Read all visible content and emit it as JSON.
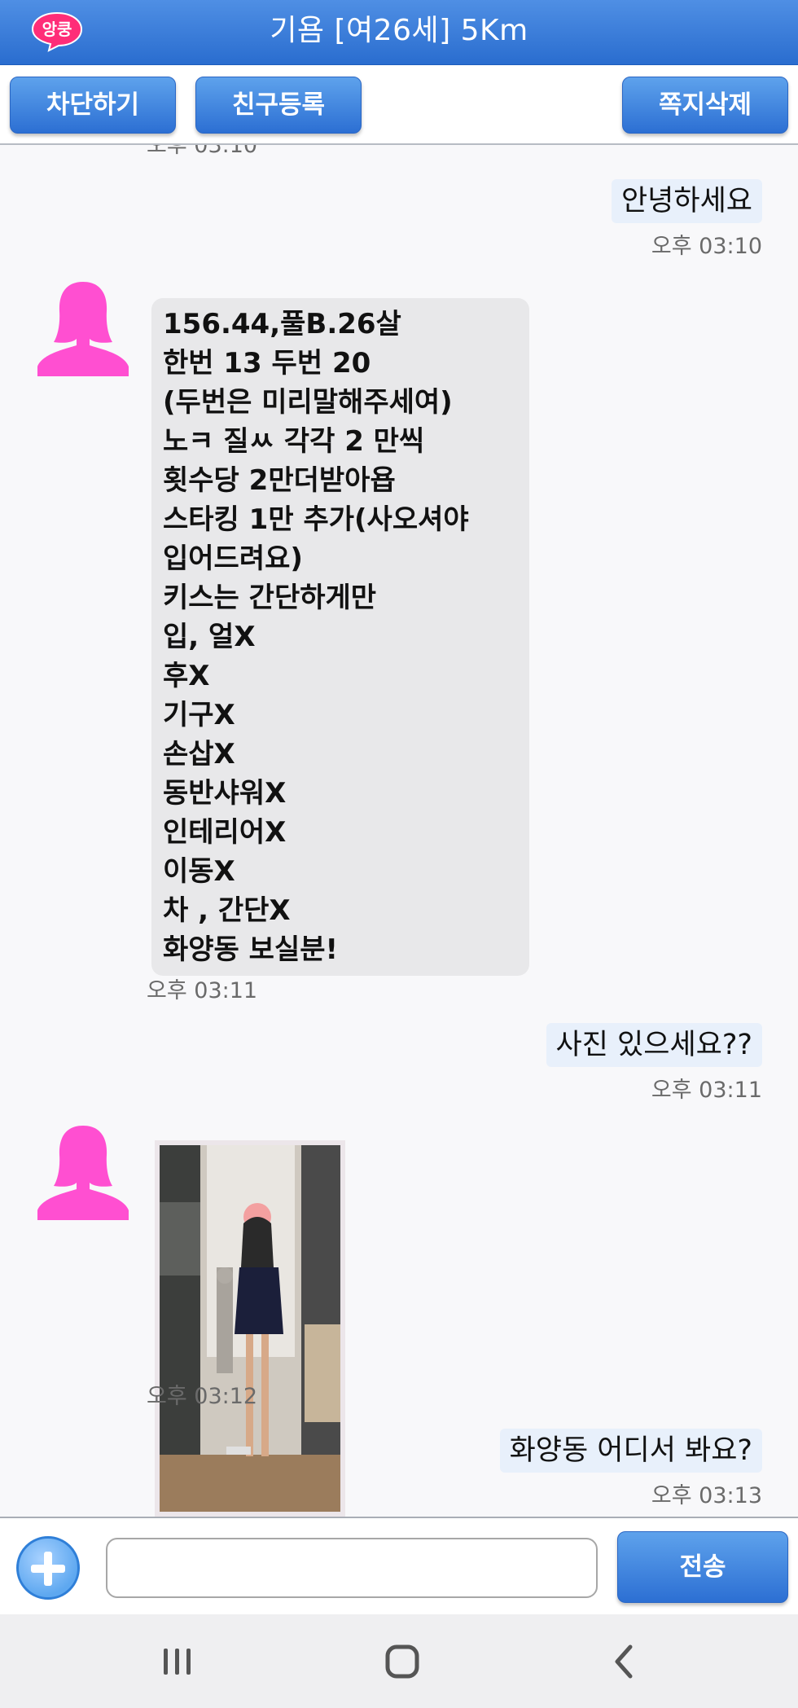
{
  "header": {
    "logo_text": "앙쿵",
    "title": "기욤 [여26세] 5Km"
  },
  "toolbar": {
    "block_label": "차단하기",
    "friend_label": "친구등록",
    "delete_label": "쪽지삭제"
  },
  "messages": {
    "clipped_time": "오후 03:10",
    "m1": {
      "text": "안녕하세요",
      "time": "오후 03:10"
    },
    "m2": {
      "lines": [
        "156.44,풀B.26살",
        "한번 13 두번 20",
        "(두번은 미리말해주세여)",
        "노ㅋ 질ㅆ 각각 2 만씩",
        "횟수당 2만더받아욥",
        "스타킹 1만 추가(사오셔야",
        "입어드려요)",
        "키스는 간단하게만",
        "입, 얼X",
        "후X",
        "기구X",
        "손삽X",
        "동반샤워X",
        "인테리어X",
        "이동X",
        "차 , 간단X",
        "화양동 보실분!"
      ],
      "time": "오후 03:11"
    },
    "m3": {
      "text": "사진 있으세요??",
      "time": "오후 03:11"
    },
    "m4": {
      "time": "오후 03:12"
    },
    "m5": {
      "text": "화양동 어디서 봐요?",
      "time": "오후 03:13"
    }
  },
  "composer": {
    "input_value": "",
    "send_label": "전송"
  },
  "colors": {
    "header_blue": "#2a6dcf",
    "avatar_pink": "#ff4fd1",
    "incoming_bubble": "#e8e8ea",
    "outgoing_bubble": "#e8f0fb"
  },
  "icons": {
    "avatar": "female-avatar-icon",
    "add": "plus-circle-icon",
    "nav_recent": "recent-apps-icon",
    "nav_home": "home-icon",
    "nav_back": "back-icon"
  }
}
